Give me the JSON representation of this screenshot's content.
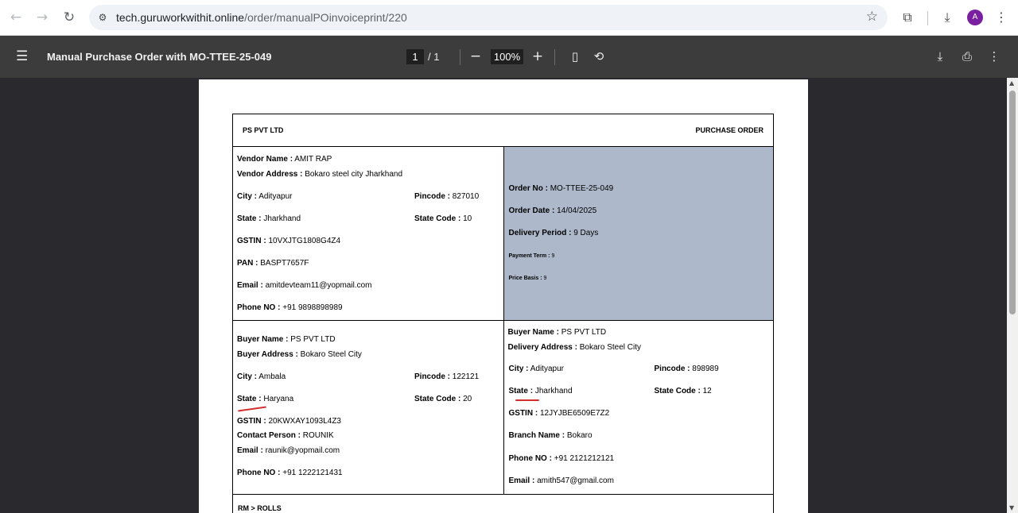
{
  "browser": {
    "url_host": "tech.guruworkwithit.online",
    "url_path": "/order/manualPOinvoiceprint/220",
    "avatar_letter": "A"
  },
  "pdf_toolbar": {
    "title": "Manual Purchase Order with MO-TTEE-25-049",
    "current_page": "1",
    "page_total": "/ 1",
    "zoom": "100%"
  },
  "document": {
    "company": "PS PVT LTD",
    "doc_type": "PURCHASE ORDER",
    "vendor": {
      "name_label": "Vendor Name :",
      "name": " AMIT RAP",
      "address_label": "Vendor Address :",
      "address": " Bokaro steel city Jharkhand",
      "city_label": "City :",
      "city": " Adityapur",
      "pincode_label": "Pincode :",
      "pincode": " 827010",
      "state_label": "State :",
      "state": " Jharkhand",
      "state_code_label": "State Code :",
      "state_code": " 10",
      "gstin_label": "GSTIN :",
      "gstin": " 10VXJTG1808G4Z4",
      "pan_label": "PAN :",
      "pan": " BASPT7657F",
      "email_label": "Email :",
      "email": " amitdevteam11@yopmail.com",
      "phone_label": "Phone NO :",
      "phone": " +91 9898898989"
    },
    "order": {
      "order_no_label": "Order No :",
      "order_no": " MO-TTEE-25-049",
      "order_date_label": "Order Date :",
      "order_date": " 14/04/2025",
      "delivery_label": "Delivery Period :",
      "delivery": " 9 Days",
      "payment_label": "Payment Term :",
      "payment": " 9",
      "price_label": "Price Basis :",
      "price": " 9"
    },
    "buyer": {
      "name_label": "Buyer Name :",
      "name": " PS PVT LTD",
      "address_label": "Buyer Address :",
      "address": " Bokaro Steel City",
      "city_label": "City :",
      "city": " Ambala",
      "pincode_label": "Pincode :",
      "pincode": " 122121",
      "state_label": "State :",
      "state": " Haryana",
      "state_code_label": "State Code :",
      "state_code": " 20",
      "gstin_label": "GSTIN :",
      "gstin": " 20KWXAY1093L4Z3",
      "contact_label": "Contact Person :",
      "contact": " ROUNIK",
      "email_label": "Email :",
      "email": " raunik@yopmail.com",
      "phone_label": "Phone NO :",
      "phone": " +91 1222121431"
    },
    "delivery_to": {
      "name_label": "Buyer Name :",
      "name": " PS PVT LTD",
      "address_label": "Delivery Address :",
      "address": " Bokaro Steel City",
      "city_label": "City :",
      "city": " Adityapur",
      "pincode_label": "Pincode :",
      "pincode": " 898989",
      "state_label": "State :",
      "state": " Jharkhand",
      "state_code_label": "State Code :",
      "state_code": " 12",
      "gstin_label": "GSTIN :",
      "gstin": " 12JYJBE6509E7Z2",
      "branch_label": "Branch Name :",
      "branch": " Bokaro",
      "phone_label": "Phone NO :",
      "phone": " +91 2121212121",
      "email_label": "Email :",
      "email": " amith547@gmail.com"
    },
    "section_label": "RM > ROLLS"
  },
  "colors": {
    "order_panel": "#adb9ca",
    "annotation": "#d32f2f",
    "viewer_bg": "#2a2a2e",
    "toolbar_bg": "#3c3c3c"
  }
}
